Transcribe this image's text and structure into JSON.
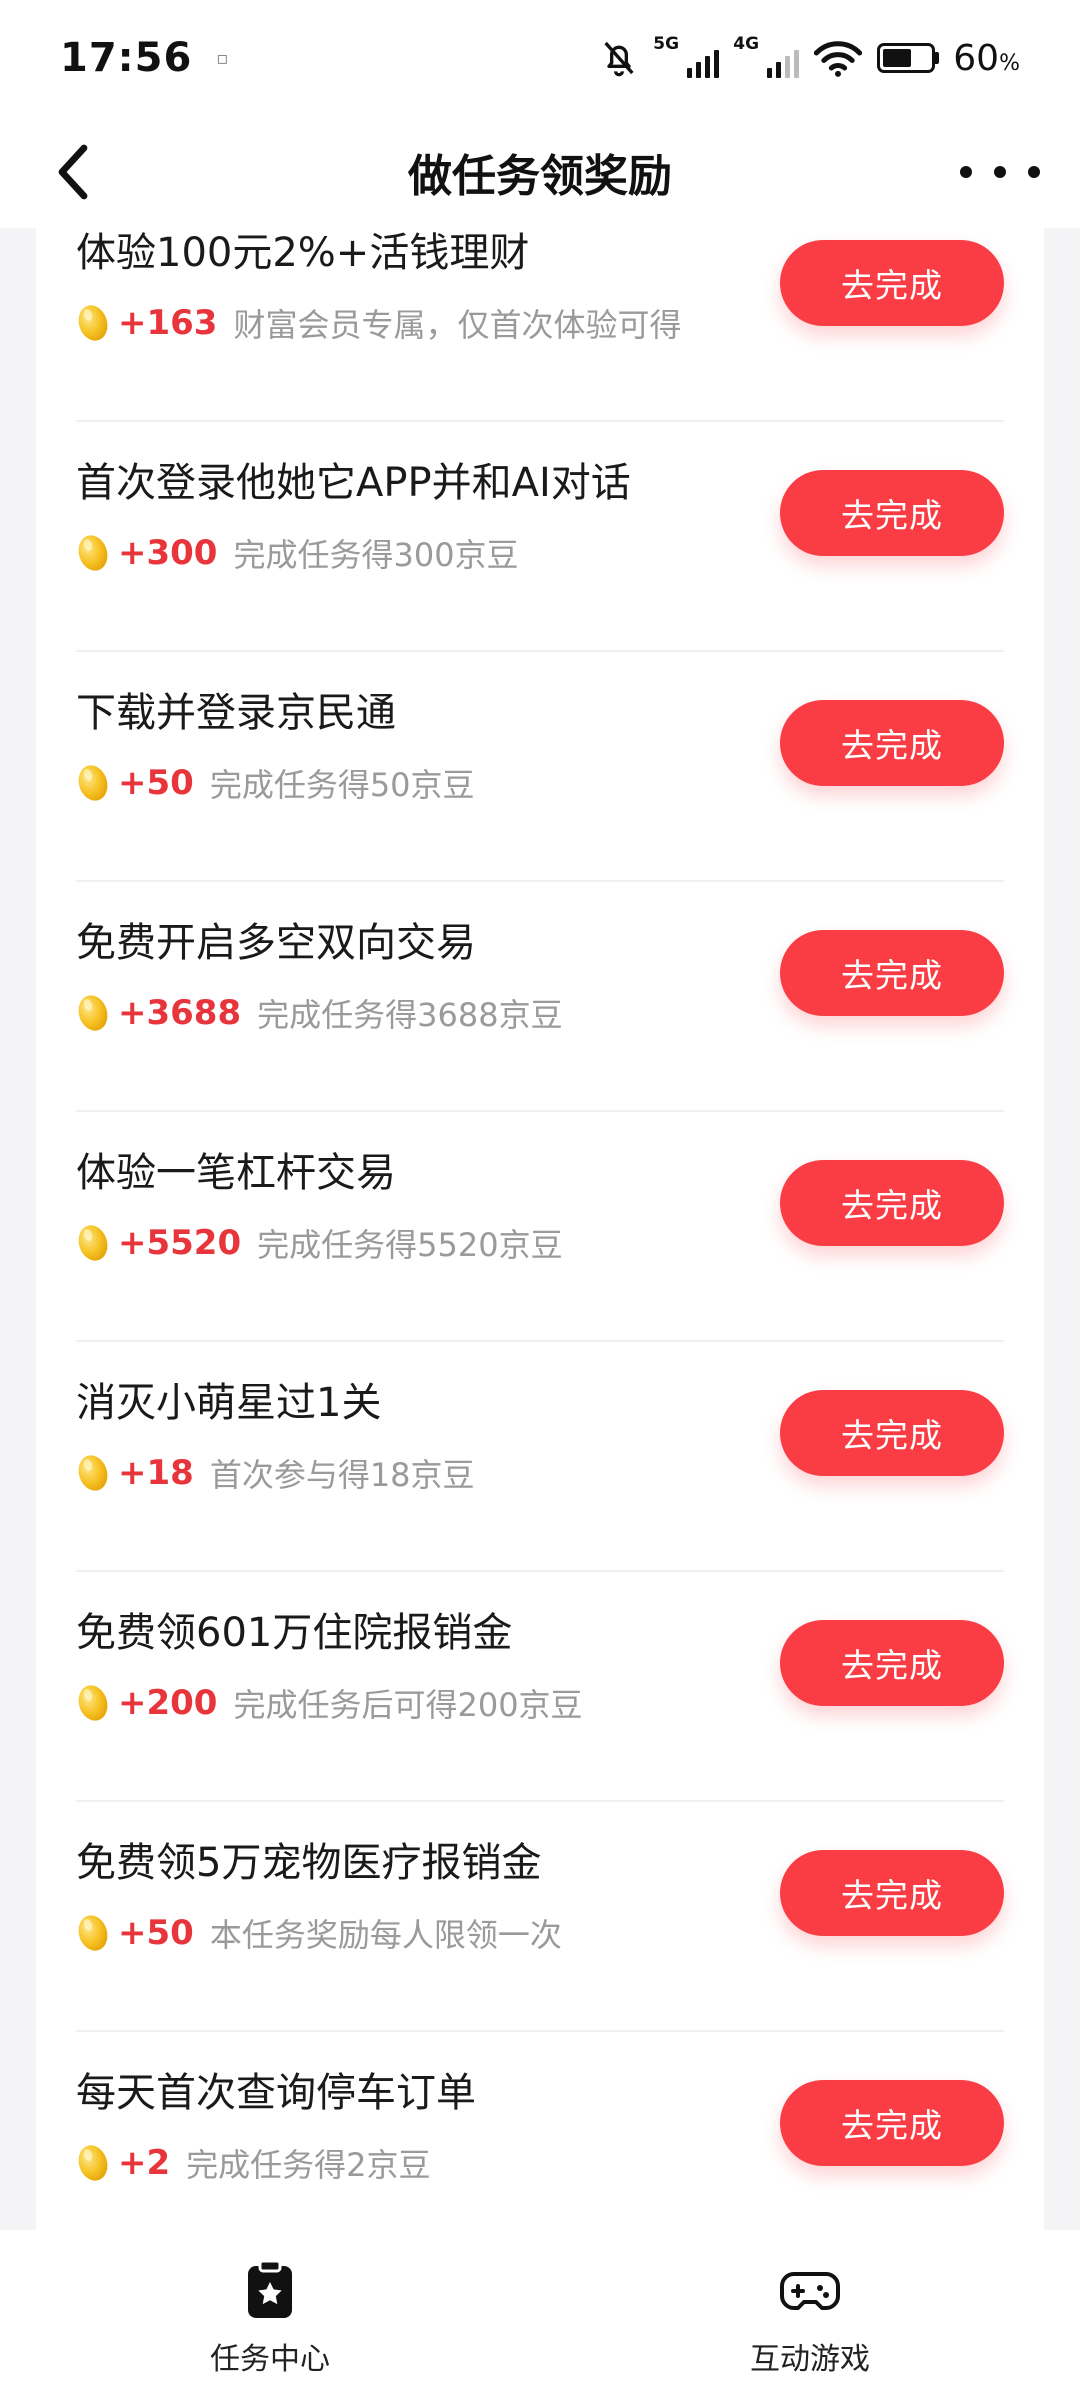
{
  "status": {
    "time": "17:56",
    "net1": "5G",
    "net2": "4G",
    "battery": "60",
    "battery_unit": "%"
  },
  "nav": {
    "title": "做任务领奖励"
  },
  "tasks": [
    {
      "title": "体验100元2%+活钱理财",
      "reward": "+163",
      "desc": "财富会员专属，仅首次体验可得",
      "button": "去完成"
    },
    {
      "title": "首次登录他她它APP并和AI对话",
      "reward": "+300",
      "desc": "完成任务得300京豆",
      "button": "去完成"
    },
    {
      "title": "下载并登录京民通",
      "reward": "+50",
      "desc": "完成任务得50京豆",
      "button": "去完成"
    },
    {
      "title": "免费开启多空双向交易",
      "reward": "+3688",
      "desc": "完成任务得3688京豆",
      "button": "去完成"
    },
    {
      "title": "体验一笔杠杆交易",
      "reward": "+5520",
      "desc": "完成任务得5520京豆",
      "button": "去完成"
    },
    {
      "title": "消灭小萌星过1关",
      "reward": "+18",
      "desc": "首次参与得18京豆",
      "button": "去完成"
    },
    {
      "title": "免费领601万住院报销金",
      "reward": "+200",
      "desc": "完成任务后可得200京豆",
      "button": "去完成"
    },
    {
      "title": "免费领5万宠物医疗报销金",
      "reward": "+50",
      "desc": "本任务奖励每人限领一次",
      "button": "去完成"
    },
    {
      "title": "每天首次查询停车订单",
      "reward": "+2",
      "desc": "完成任务得2京豆",
      "button": "去完成"
    }
  ],
  "tabs": [
    {
      "label": "任务中心",
      "icon": "clipboard-star-icon",
      "active": true
    },
    {
      "label": "互动游戏",
      "icon": "gamepad-icon",
      "active": false
    }
  ],
  "colors": {
    "accent": "#fa3c44",
    "reward": "#e8353c",
    "bean": "#f7c325"
  }
}
